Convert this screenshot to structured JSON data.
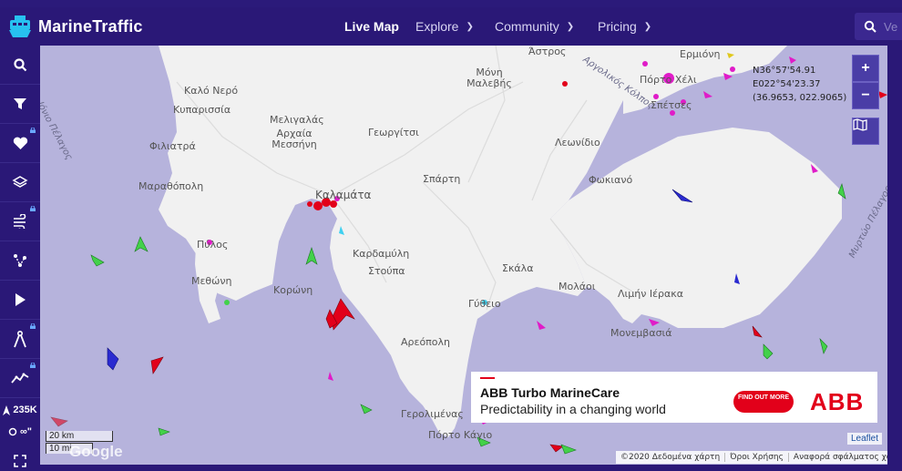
{
  "brand": {
    "name": "MarineTraffic",
    "logo_icon": "ship-logo-icon"
  },
  "nav": {
    "live_map": "Live Map",
    "explore": "Explore",
    "community": "Community",
    "pricing": "Pricing",
    "search_placeholder": "Ve"
  },
  "sidebar": {
    "items": [
      {
        "icon": "search-icon"
      },
      {
        "icon": "filter-icon"
      },
      {
        "icon": "heart-icon",
        "locked": true
      },
      {
        "icon": "layers-icon"
      },
      {
        "icon": "wind-icon",
        "locked": true
      },
      {
        "icon": "route-icon"
      },
      {
        "icon": "play-icon"
      },
      {
        "icon": "compass-icon",
        "locked": true
      },
      {
        "icon": "analytics-icon",
        "locked": true
      }
    ],
    "vessel_count": "235K",
    "tracks_label": "∞\""
  },
  "map": {
    "coords": {
      "lat": "N36°57'54.91",
      "lon": "E022°54'23.37",
      "decimal": "(36.9653, 022.9065)"
    },
    "zoom_in": "+",
    "zoom_out": "−",
    "places": [
      "Καλό Νερό",
      "Κυπαρισσία",
      "Μελιγαλάς",
      "Αρχαία Μεσσήνη",
      "Φιλιατρά",
      "Γεωργίτσι",
      "Μαραθόπολη",
      "Καλαμάτα",
      "Σπάρτη",
      "Πύλος",
      "Καρδαμύλη",
      "Στούπα",
      "Μεθώνη",
      "Κορώνη",
      "Σκάλα",
      "Μολάοι",
      "Λιμήν Ιέρακα",
      "Γύθειο",
      "Αρεόπολη",
      "Μονεμβασιά",
      "Γερολιμένας",
      "Πόρτο Κάγιο",
      "Λεωνίδιο",
      "Φωκιανό",
      "Μόνη Μαλεβής",
      "Άστρος",
      "Πόρτο Χέλι",
      "Σπέτσες",
      "Ερμιόνη"
    ],
    "seas": [
      "Ιόνιο Πέλαγος",
      "Αργολικός Κόλπος",
      "Μυρτώο Πέλαγος"
    ],
    "scale_km": "20 km",
    "scale_mi": "10 mi",
    "google": "Google",
    "leaflet": "Leaflet",
    "attribution": [
      "©2020 Δεδομένα χάρτη",
      "Όροι Χρήσης",
      "Αναφορά σφάλματος χάρτη"
    ]
  },
  "ad": {
    "title": "ABB Turbo MarineCare",
    "subtitle": "Predictability in a changing world",
    "button": "FIND OUT MORE",
    "logo": "ABB"
  },
  "colors": {
    "topbar": "#2a1877",
    "sea": "#b6b3dc",
    "land": "#f1f1f1",
    "cargo": "#43d14a",
    "tanker": "#e2001a",
    "passenger": "#2a2ad0",
    "pleasure": "#e01cc8",
    "ad_red": "#e2001a"
  }
}
